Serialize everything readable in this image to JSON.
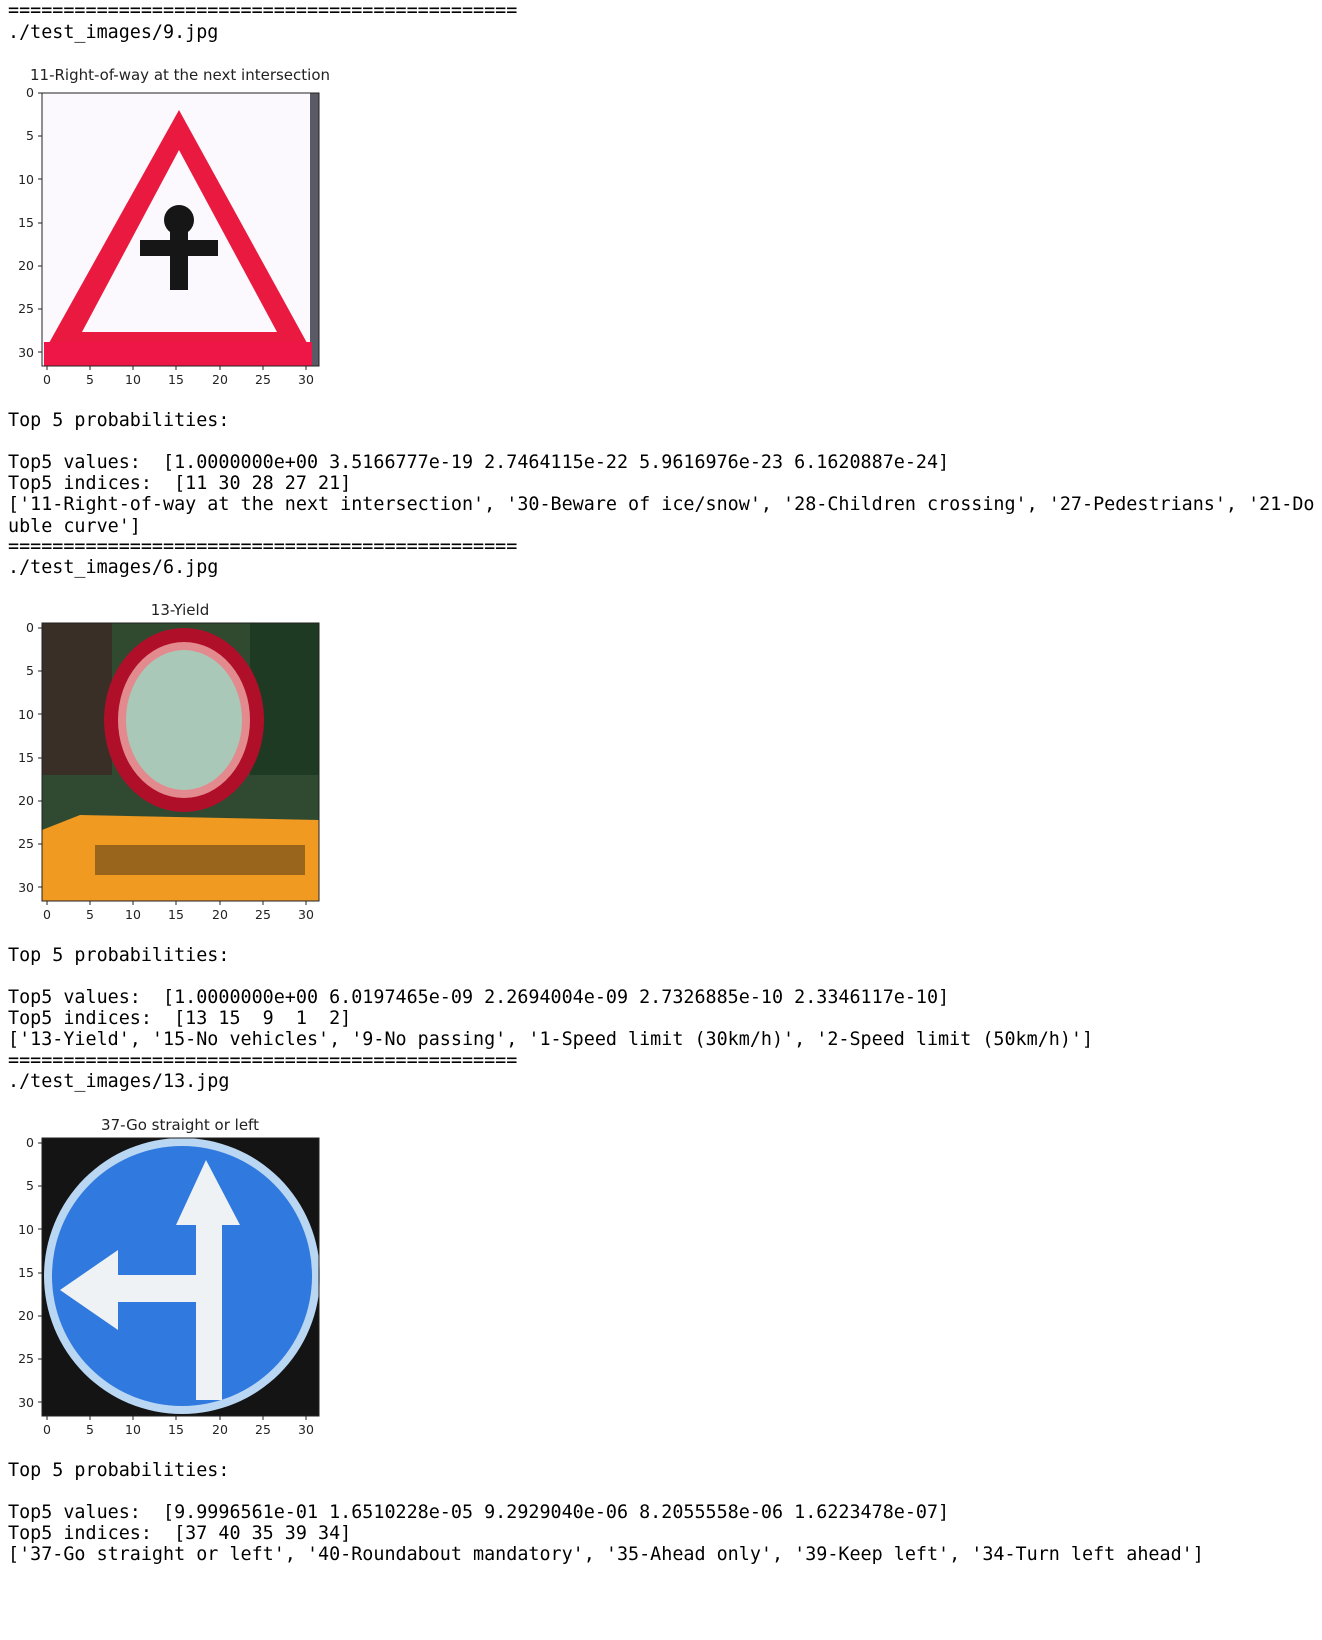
{
  "separator": "==============================================",
  "x_ticks": [
    "0",
    "5",
    "10",
    "15",
    "20",
    "25",
    "30"
  ],
  "y_ticks": [
    "0",
    "5",
    "10",
    "15",
    "20",
    "25",
    "30"
  ],
  "results": [
    {
      "path": "./test_images/9.jpg",
      "title": "11-Right-of-way at the next intersection",
      "image_icon": "right-of-way-triangle-sign",
      "top5_header": "Top 5 probabilities:",
      "values_line": "Top5 values:  [1.0000000e+00 3.5166777e-19 2.7464115e-22 5.9616976e-23 6.1620887e-24]",
      "indices_line": "Top5 indices:  [11 30 28 27 21]",
      "labels_line": "['11-Right-of-way at the next intersection', '30-Beware of ice/snow', '28-Children crossing', '27-Pedestrians', '21-Double curve']"
    },
    {
      "path": "./test_images/6.jpg",
      "title": "13-Yield",
      "image_icon": "no-vehicles-sign-with-detour-board",
      "top5_header": "Top 5 probabilities:",
      "values_line": "Top5 values:  [1.0000000e+00 6.0197465e-09 2.2694004e-09 2.7326885e-10 2.3346117e-10]",
      "indices_line": "Top5 indices:  [13 15  9  1  2]",
      "labels_line": "['13-Yield', '15-No vehicles', '9-No passing', '1-Speed limit (30km/h)', '2-Speed limit (50km/h)']"
    },
    {
      "path": "./test_images/13.jpg",
      "title": "37-Go straight or left",
      "image_icon": "go-straight-or-left-sign",
      "top5_header": "Top 5 probabilities:",
      "values_line": "Top5 values:  [9.9996561e-01 1.6510228e-05 9.2929040e-06 8.2055558e-06 1.6223478e-07]",
      "indices_line": "Top5 indices:  [37 40 35 39 34]",
      "labels_line": "['37-Go straight or left', '40-Roundabout mandatory', '35-Ahead only', '39-Keep left', '34-Turn left ahead']"
    }
  ]
}
